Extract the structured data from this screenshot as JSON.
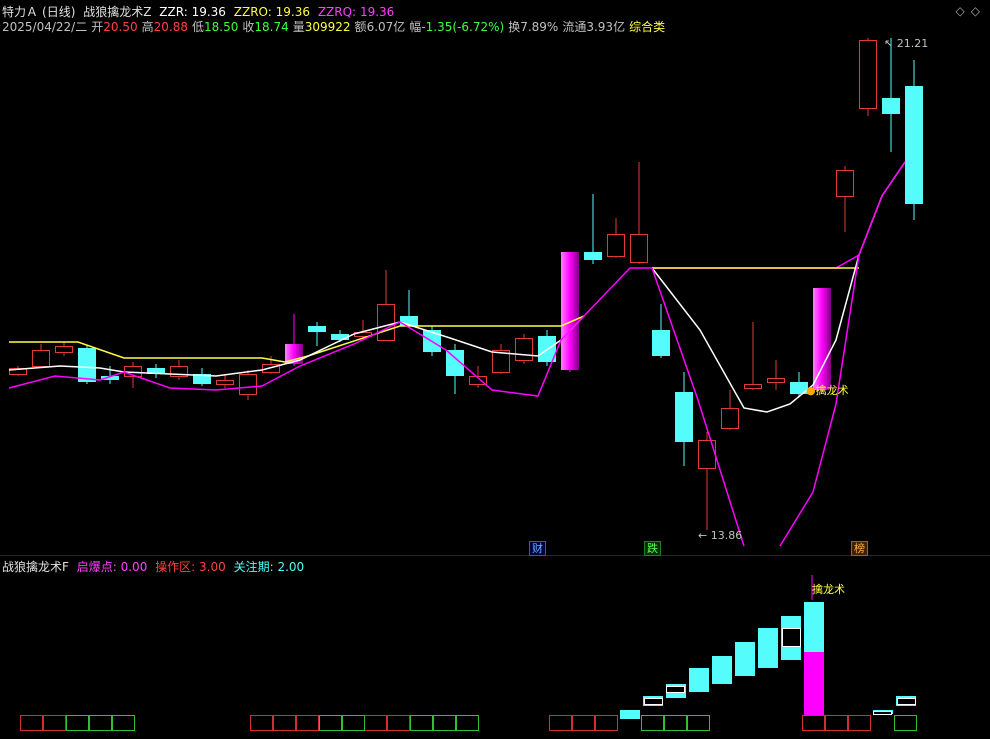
{
  "header": {
    "stock_name": "特力Ａ",
    "period": "(日线)",
    "indicator_name": "战狼擒龙术Z",
    "zzr_label": "ZZR:",
    "zzr_value": "19.36",
    "zzro_label": "ZZRO:",
    "zzro_value": "19.36",
    "zzrq_label": "ZZRQ:",
    "zzrq_value": "19.36"
  },
  "quote": {
    "date": "2025/04/22/二",
    "open_label": "开",
    "open": "20.50",
    "high_label": "高",
    "high": "20.88",
    "low_label": "低",
    "low": "18.50",
    "close_label": "收",
    "close": "18.74",
    "volume_label": "量",
    "volume": "309922",
    "amount_label": "额",
    "amount": "6.07亿",
    "change_label": "幅",
    "change": "-1.35(-6.72%)",
    "turnover_label": "换",
    "turnover": "7.89%",
    "float_label": "流通",
    "float": "3.93亿",
    "category": "综合类"
  },
  "sub_header": {
    "indicator_name": "战狼擒龙术F",
    "qibao_label": "启爆点:",
    "qibao_value": "0.00",
    "caozuo_label": "操作区:",
    "caozuo_value": "3.00",
    "guanzhu_label": "关注期:",
    "guanzhu_value": "2.00"
  },
  "annotations": {
    "high_price": "21.21",
    "low_price": "13.86",
    "signal_main": "擒龙术",
    "signal_sub": "擒龙术",
    "event_cai": "财",
    "event_die": "跌",
    "event_bang": "榜"
  },
  "icons": {
    "top_right_1": "diamond-icon",
    "top_right_2": "diamond-outline-icon"
  },
  "colors": {
    "up": "#e03a3a",
    "down": "#54fcfc",
    "magenta": "#ff00ff",
    "yellow": "#ffff40",
    "white": "#ffffff"
  }
}
